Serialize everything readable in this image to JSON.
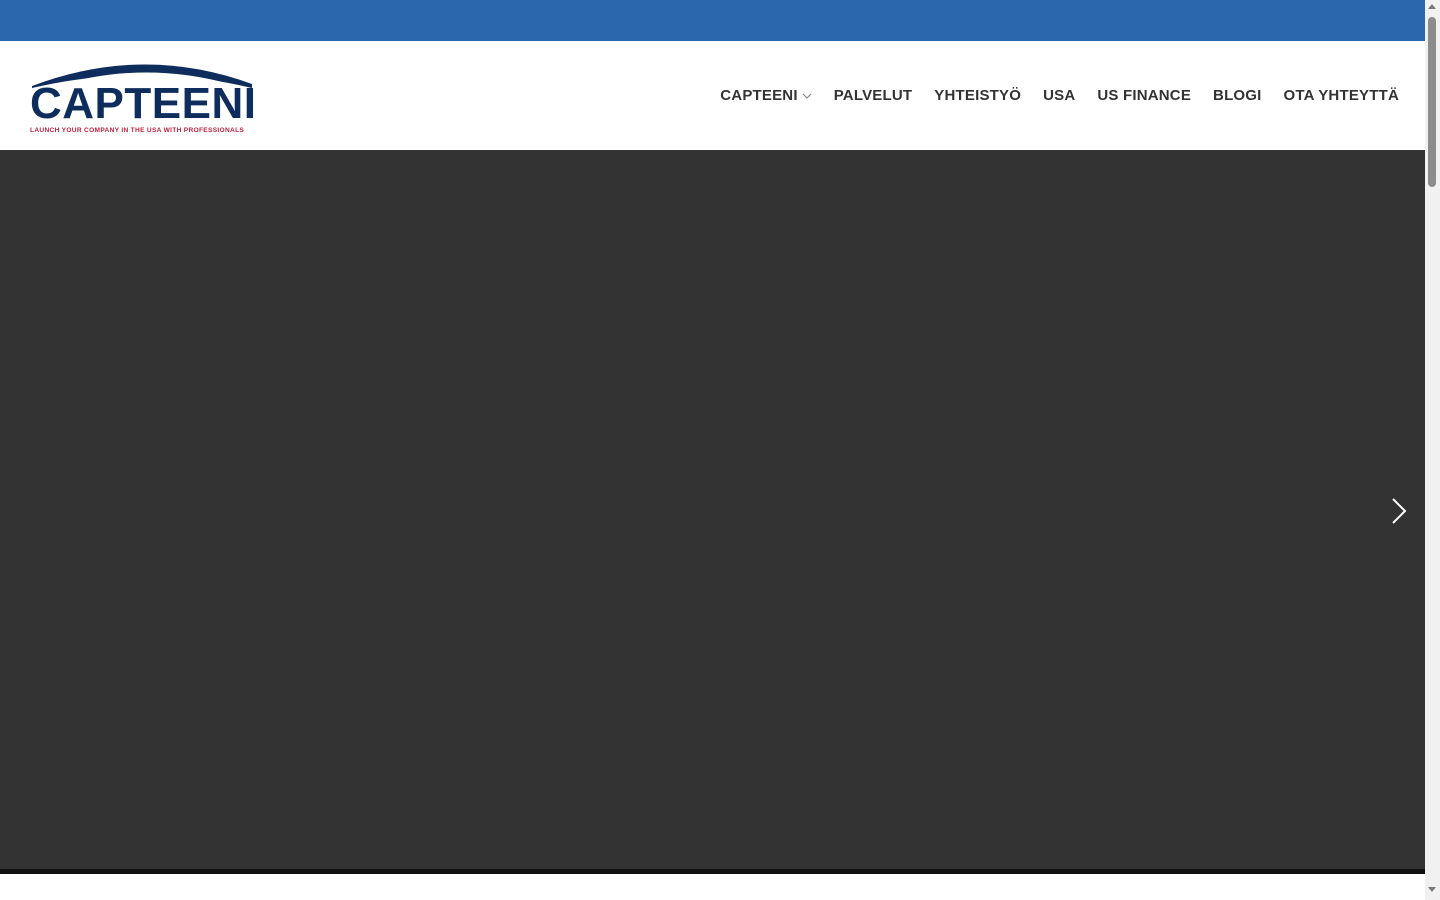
{
  "colors": {
    "top_bar": "#2b67ad",
    "logo_primary": "#0e2d5c",
    "logo_tagline": "#b8233f",
    "nav_text": "#333333",
    "hero_background": "#333333"
  },
  "header": {
    "logo": {
      "wordmark": "CAPTEENI",
      "tagline": "LAUNCH YOUR COMPANY IN THE USA WITH PROFESSIONALS"
    },
    "nav": [
      {
        "label": "CAPTEENI",
        "icon": "chevron-down-icon"
      },
      {
        "label": "PALVELUT"
      },
      {
        "label": "YHTEISTYÖ"
      },
      {
        "label": "USA"
      },
      {
        "label": "US FINANCE"
      },
      {
        "label": "BLOGI"
      },
      {
        "label": "OTA YHTEYTTÄ"
      }
    ]
  },
  "hero": {
    "next_icon": "chevron-right-icon"
  }
}
